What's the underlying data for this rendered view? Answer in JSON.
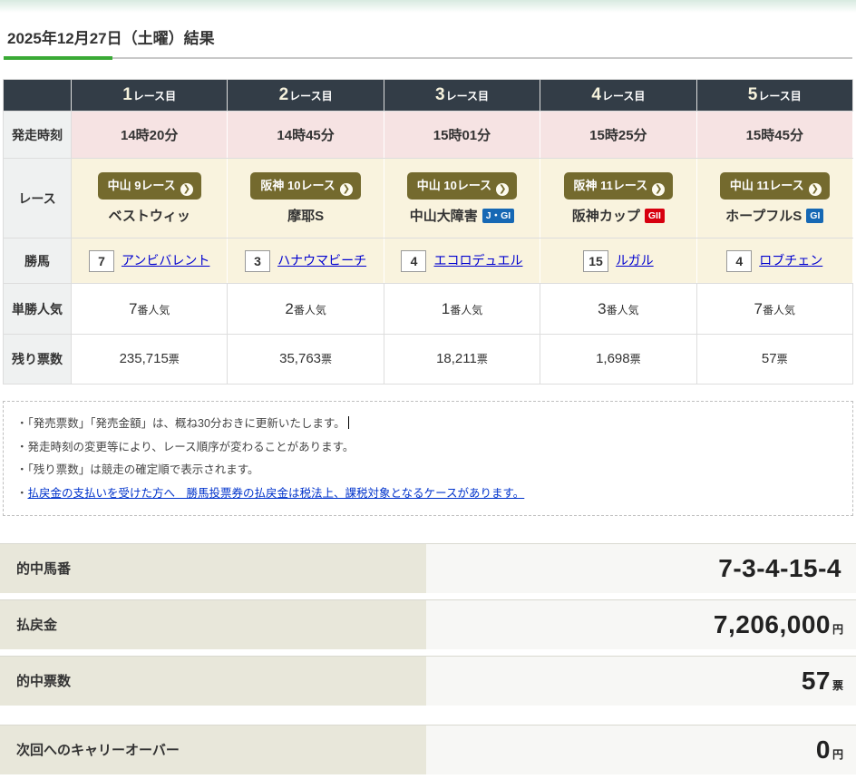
{
  "page": {
    "title": "2025年12月27日（土曜）結果"
  },
  "colors": {
    "accent_green": "#3aaa35",
    "table_header_bg": "#333d47",
    "race_button_bg": "#746a2e",
    "time_row_bg": "#f6e3e3",
    "race_row_bg": "#f9f3de",
    "row_label_bg": "#eff1f1",
    "grade_blue": "#1668b4",
    "grade_red": "#d7000f",
    "link_blue": "#0000d0",
    "summary_label_bg": "#e8e7da",
    "summary_value_bg": "#f7f7f5"
  },
  "results_table": {
    "row_labels": {
      "start_time": "発走時刻",
      "race": "レース",
      "winner": "勝馬",
      "popularity": "単勝人気",
      "remaining_votes": "残り票数"
    },
    "columns": [
      {
        "header_num": "1",
        "header_suffix": "レース目",
        "start_time": "14時20分",
        "race_button": "中山 9レース",
        "arrow_icon": "❯",
        "race_name": "ベストウィッ",
        "grade": null,
        "winner_num": "7",
        "winner_name": "アンビバレント",
        "pop_num": "7",
        "pop_suffix": "番人気",
        "votes": "235,715",
        "votes_unit": "票"
      },
      {
        "header_num": "2",
        "header_suffix": "レース目",
        "start_time": "14時45分",
        "race_button": "阪神 10レース",
        "arrow_icon": "❯",
        "race_name": "摩耶S",
        "grade": null,
        "winner_num": "3",
        "winner_name": "ハナウマビーチ",
        "pop_num": "2",
        "pop_suffix": "番人気",
        "votes": "35,763",
        "votes_unit": "票"
      },
      {
        "header_num": "3",
        "header_suffix": "レース目",
        "start_time": "15時01分",
        "race_button": "中山 10レース",
        "arrow_icon": "❯",
        "race_name": "中山大障害",
        "grade": {
          "label": "J・GI",
          "bg": "#1668b4"
        },
        "winner_num": "4",
        "winner_name": "エコロデュエル",
        "pop_num": "1",
        "pop_suffix": "番人気",
        "votes": "18,211",
        "votes_unit": "票"
      },
      {
        "header_num": "4",
        "header_suffix": "レース目",
        "start_time": "15時25分",
        "race_button": "阪神 11レース",
        "arrow_icon": "❯",
        "race_name": "阪神カップ",
        "grade": {
          "label": "GII",
          "bg": "#d7000f"
        },
        "winner_num": "15",
        "winner_name": "ルガル",
        "pop_num": "3",
        "pop_suffix": "番人気",
        "votes": "1,698",
        "votes_unit": "票"
      },
      {
        "header_num": "5",
        "header_suffix": "レース目",
        "start_time": "15時45分",
        "race_button": "中山 11レース",
        "arrow_icon": "❯",
        "race_name": "ホープフルS",
        "grade": {
          "label": "GI",
          "bg": "#1668b4"
        },
        "winner_num": "4",
        "winner_name": "ロブチェン",
        "pop_num": "7",
        "pop_suffix": "番人気",
        "votes": "57",
        "votes_unit": "票"
      }
    ]
  },
  "notes": {
    "bullet": "・",
    "items": [
      "「発売票数」「発売金額」は、概ね30分おきに更新いたします。",
      "発走時刻の変更等により、レース順序が変わることがあります。",
      "「残り票数」は競走の確定順で表示されます。"
    ],
    "link_text": "払戻金の支払いを受けた方へ　勝馬投票券の払戻金は税法上、課税対象となるケースがあります。"
  },
  "summary": {
    "rows": [
      {
        "label": "的中馬番",
        "value": "7-3-4-15-4",
        "unit": ""
      },
      {
        "label": "払戻金",
        "value": "7,206,000",
        "unit": "円"
      },
      {
        "label": "的中票数",
        "value": "57",
        "unit": "票"
      },
      {
        "label": "次回へのキャリーオーバー",
        "value": "0",
        "unit": "円"
      }
    ]
  }
}
